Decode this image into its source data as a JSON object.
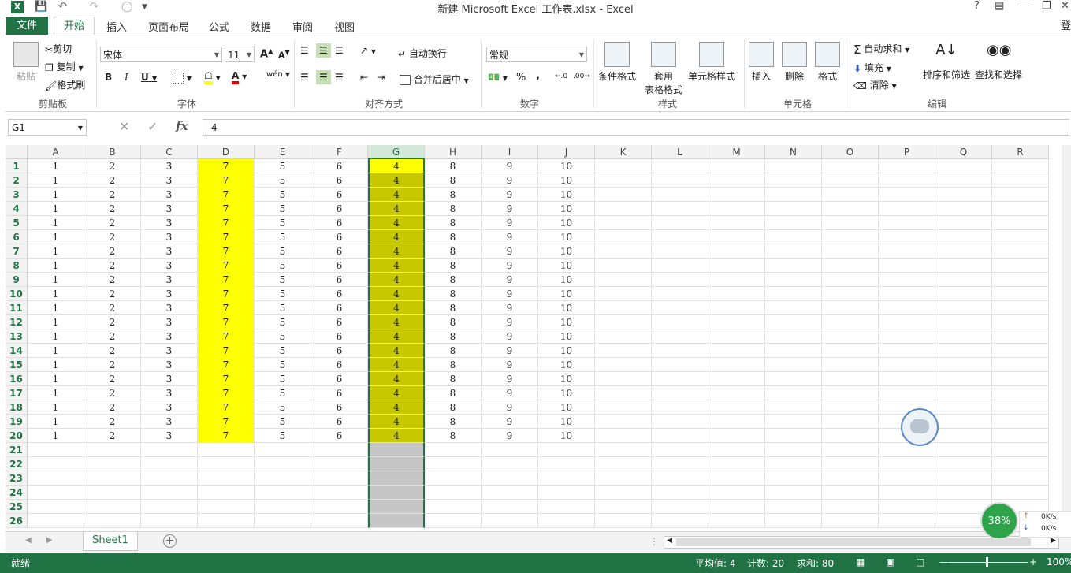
{
  "window": {
    "title": "新建 Microsoft Excel 工作表.xlsx - Excel",
    "help": "?"
  },
  "user": {
    "sign_in": "登"
  },
  "tabs": [
    "文件",
    "开始",
    "插入",
    "页面布局",
    "公式",
    "数据",
    "审阅",
    "视图"
  ],
  "ribbon": {
    "clipboard": {
      "label": "剪贴板",
      "paste": "粘贴",
      "cut": "剪切",
      "copy": "复制",
      "painter": "格式刷"
    },
    "font": {
      "label": "字体",
      "name": "宋体",
      "size": "11",
      "bold": "B",
      "italic": "I",
      "underline": "U",
      "grow": "A",
      "shrink": "A",
      "wen": "wén",
      "color_a": "A"
    },
    "alignment": {
      "label": "对齐方式",
      "wrap": "自动换行",
      "merge": "合并后居中"
    },
    "number": {
      "label": "数字",
      "format": "常规",
      "percent": "%",
      "comma": ","
    },
    "styles": {
      "label": "样式",
      "conditional": "条件格式",
      "table1": "套用",
      "table2": "表格格式",
      "cell": "单元格样式"
    },
    "cells": {
      "label": "单元格",
      "insert": "插入",
      "delete": "删除",
      "format": "格式"
    },
    "editing": {
      "label": "编辑",
      "autosum": "自动求和",
      "fill": "填充",
      "clear": "清除",
      "sort": "排序和筛选",
      "find": "查找和选择"
    }
  },
  "formula_bar": {
    "name_box": "G1",
    "value": "4",
    "fx": "fx"
  },
  "grid": {
    "columns": [
      "A",
      "B",
      "C",
      "D",
      "E",
      "F",
      "G",
      "H",
      "I",
      "J",
      "K",
      "L",
      "M",
      "N",
      "O",
      "P",
      "Q",
      "R"
    ],
    "selected_column": "G",
    "row_values": [
      "1",
      "2",
      "3",
      "7",
      "5",
      "6",
      "4",
      "8",
      "9",
      "10"
    ],
    "row_count_data": 20,
    "row_count_visible": 26,
    "highlight_d_color": "#ffff00",
    "selection_color": "#c8c800",
    "active_cell_color": "#ffff00",
    "empty_selection_color": "#c6c6c6"
  },
  "sheets": [
    "Sheet1"
  ],
  "status": {
    "ready": "就绪",
    "average": "平均值: 4",
    "count": "计数: 20",
    "sum": "求和: 80",
    "zoom": "100%"
  },
  "network_widget": {
    "percent": "38%",
    "up": "0K/s",
    "down": "0K/s"
  }
}
